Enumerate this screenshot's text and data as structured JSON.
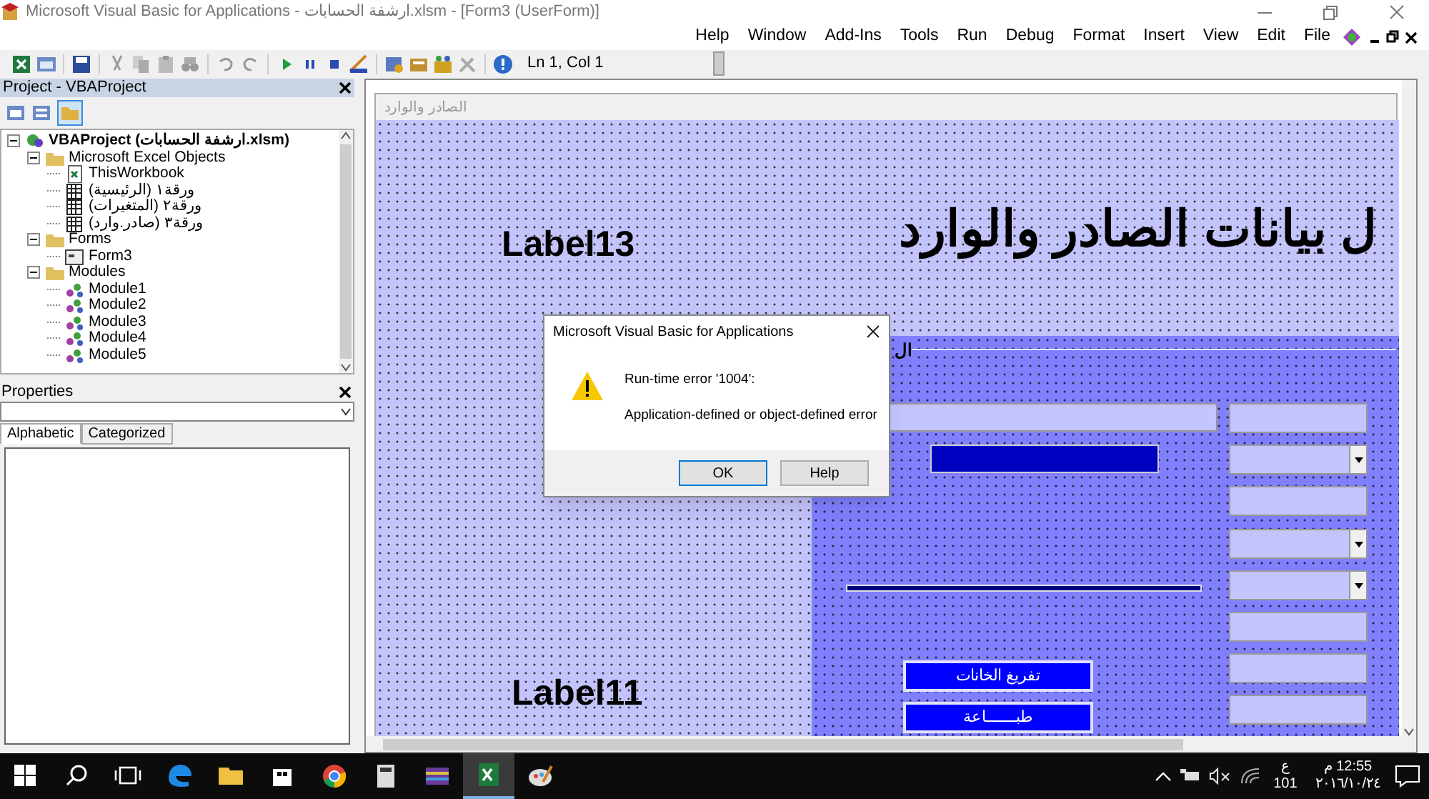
{
  "window": {
    "title": "Microsoft Visual Basic for Applications - ارشفة الحسابات.xlsm - [Form3 (UserForm)]"
  },
  "menu": [
    "Help",
    "Window",
    "Add-Ins",
    "Tools",
    "Run",
    "Debug",
    "Format",
    "Insert",
    "View",
    "Edit",
    "File"
  ],
  "toolbar": {
    "position": "Ln 1, Col 1"
  },
  "project_panel": {
    "title": "Project - VBAProject",
    "tree": [
      {
        "label": "VBAProject (ارشفة الحسابات.xlsm)",
        "kind": "project",
        "children": [
          {
            "label": "Microsoft Excel Objects",
            "kind": "folder",
            "children": [
              {
                "label": "ThisWorkbook",
                "kind": "workbook"
              },
              {
                "label": "ورقة١ (الرئيسية)",
                "kind": "sheet"
              },
              {
                "label": "ورقة٢ (المتغيرات)",
                "kind": "sheet"
              },
              {
                "label": "ورقة٣ (صادر.وارد)",
                "kind": "sheet"
              }
            ]
          },
          {
            "label": "Forms",
            "kind": "folder",
            "children": [
              {
                "label": "Form3",
                "kind": "form"
              }
            ]
          },
          {
            "label": "Modules",
            "kind": "folder",
            "children": [
              {
                "label": "Module1",
                "kind": "module"
              },
              {
                "label": "Module2",
                "kind": "module"
              },
              {
                "label": "Module3",
                "kind": "module"
              },
              {
                "label": "Module4",
                "kind": "module"
              },
              {
                "label": "Module5",
                "kind": "module"
              }
            ]
          }
        ]
      }
    ]
  },
  "properties_panel": {
    "title": "Properties",
    "tabs": [
      {
        "label": "Alphabetic",
        "selected": true
      },
      {
        "label": "Categorized",
        "selected": false
      }
    ]
  },
  "user_form": {
    "title": "الصادر والوارد",
    "heading": "ل بيانات الصادر والوارد",
    "labels": [
      "Label13",
      "Label11"
    ],
    "frame": {
      "caption": "ال",
      "controls": [
        {
          "kind": "textbox"
        },
        {
          "kind": "combobox"
        },
        {
          "kind": "textbox"
        },
        {
          "kind": "combobox"
        },
        {
          "kind": "combobox"
        },
        {
          "kind": "textbox"
        },
        {
          "kind": "textbox"
        },
        {
          "kind": "textbox"
        }
      ],
      "buttons": [
        "تفريغ الخانات",
        "طبـــــــاعة"
      ]
    }
  },
  "dialog": {
    "title": "Microsoft Visual Basic for Applications",
    "message": "Run-time error '1004':",
    "detail": "Application-defined or object-defined error",
    "buttons": [
      "OK",
      "Help"
    ]
  },
  "taskbar": {
    "language": "ع",
    "layout": "101",
    "time": "12:55 م",
    "date": "٢٠١٦/١٠/٢٤"
  }
}
